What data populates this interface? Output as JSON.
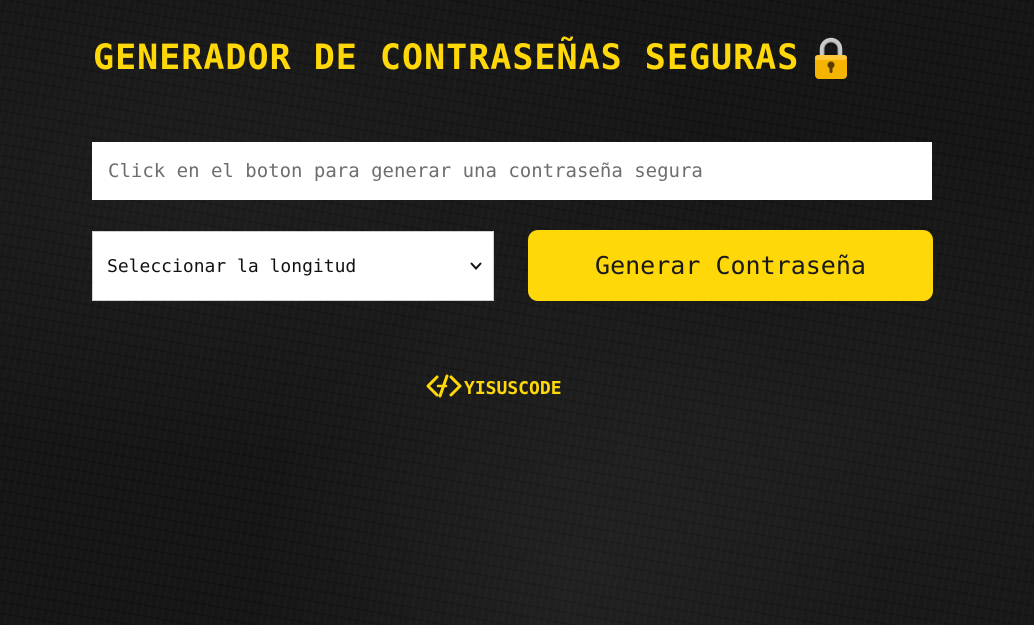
{
  "header": {
    "title": "GENERADOR DE CONTRASEÑAS SEGURAS",
    "icon": "lock-icon"
  },
  "password_field": {
    "value": "",
    "placeholder": "Click en el boton para generar una contraseña segura"
  },
  "length_select": {
    "selected": "Seleccionar la longitud",
    "icon": "chevron-down-icon"
  },
  "generate_button": {
    "label": "Generar Contraseña"
  },
  "footer": {
    "brand": "YISUSCODE",
    "icon": "code-icon"
  },
  "colors": {
    "accent": "#ffd80a",
    "background": "#161616",
    "field": "#ffffff"
  }
}
